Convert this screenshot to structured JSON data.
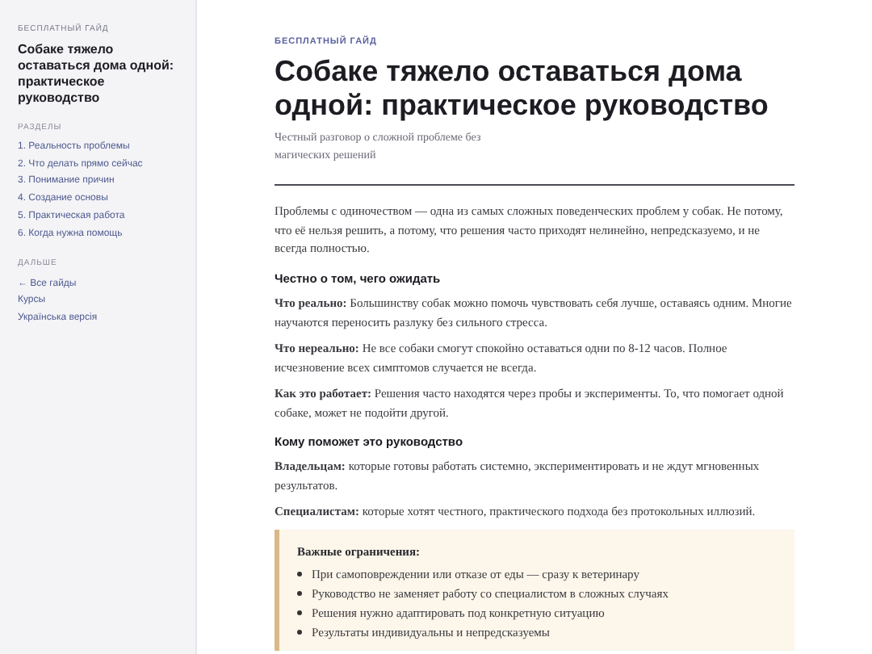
{
  "sidebar": {
    "eyebrow": "БЕСПЛАТНЫЙ ГАЙД",
    "title": "Собаке тяжело оставаться дома одной: практическое руководство",
    "sections": [
      {
        "heading": "РАЗДЕЛЫ",
        "links": [
          "1. Реальность проблемы",
          "2. Что делать прямо сейчас",
          "3. Понимание причин",
          "4. Создание основы",
          "5. Практическая работа",
          "6. Когда нужна помощь"
        ]
      },
      {
        "heading": "ДАЛЬШЕ",
        "links": [
          "← Все гайды",
          "Курсы",
          "Українська версія"
        ]
      }
    ]
  },
  "article": {
    "eyebrow": "БЕСПЛАТНЫЙ ГАЙД",
    "title": "Собаке тяжело оставаться дома одной: практическое руководство",
    "subtitle": "Честный разговор о сложной проблеме без магических решений",
    "blocks": [
      {
        "kind": "paragraph",
        "text": "Проблемы с одиночеством — одна из самых сложных поведенческих проблем у собак. Не потому, что её нельзя решить, а потому, что решения часто приходят нелинейно, непредсказуемо, и не всегда полностью."
      },
      {
        "kind": "heading",
        "text": "Честно о том, чего ожидать"
      },
      {
        "kind": "paragraph",
        "text": "**Что реально:** Большинству собак можно помочь чувствовать себя лучше, оставаясь одним. Многие научаются переносить разлуку без сильного стресса."
      },
      {
        "kind": "paragraph",
        "text": "**Что нереально:** Не все собаки смогут спокойно оставаться одни по 8-12 часов. Полное исчезновение всех симптомов случается не всегда."
      },
      {
        "kind": "paragraph",
        "text": "**Как это работает:** Решения часто находятся через пробы и эксперименты. То, что помогает одной собаке, может не подойти другой."
      },
      {
        "kind": "heading",
        "text": "Кому поможет это руководство"
      },
      {
        "kind": "paragraph",
        "text": "**Владельцам:** которые готовы работать системно, экспериментировать и не ждут мгновенных результатов."
      },
      {
        "kind": "paragraph",
        "text": "**Специалистам:** которые хотят честного, практического подхода без протокольных иллюзий."
      },
      {
        "kind": "callout",
        "title": "Важные ограничения:",
        "items": [
          "При самоповреждении или отказе от еды — сразу к ветеринару",
          "Руководство не заменяет работу со специалистом в сложных случаях",
          "Решения нужно адаптировать под конкретную ситуацию",
          "Результаты индивидуальны и непредсказуемы"
        ]
      }
    ]
  }
}
